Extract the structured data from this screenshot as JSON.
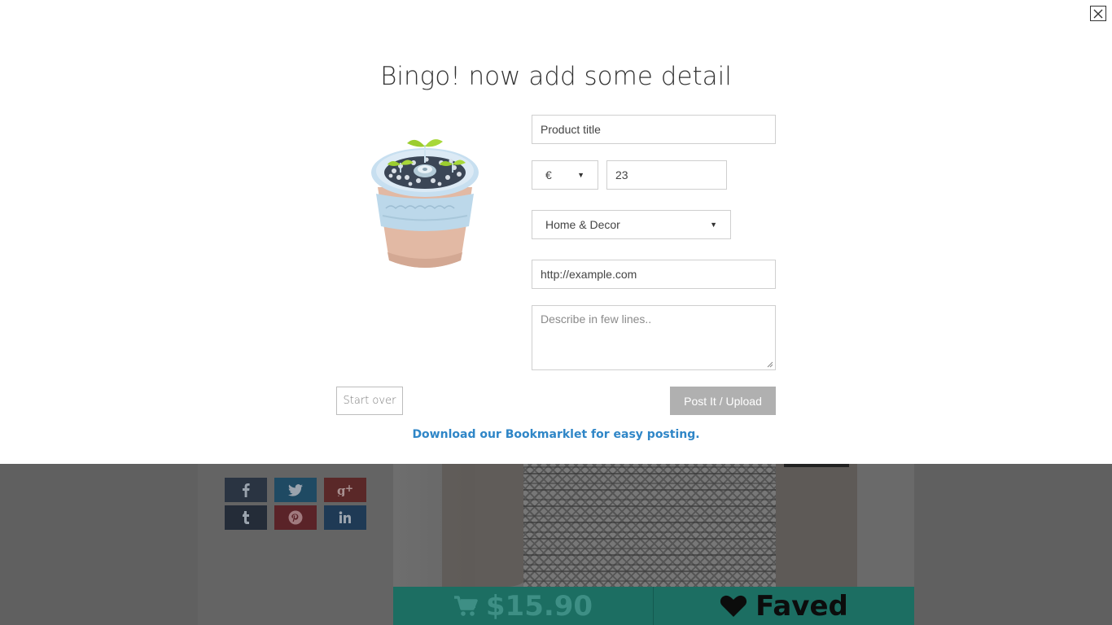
{
  "modal": {
    "title": "Bingo! now add some detail",
    "close_icon": "close-icon",
    "form": {
      "product_title_value": "Product title",
      "currency_value": "€",
      "price_value": "23",
      "category_value": "Home & Decor",
      "url_value": "http://example.com",
      "description_placeholder": "Describe in few lines.."
    },
    "start_over_label": "Start over",
    "post_label": "Post It / Upload",
    "bookmarklet_text": "Download our Bookmarklet for easy posting."
  },
  "background": {
    "share_icons": [
      "facebook-icon",
      "twitter-icon",
      "google-plus-icon",
      "tumblr-icon",
      "pinterest-icon",
      "linkedin-icon"
    ],
    "price_text": "$15.90",
    "faved_text": "Faved"
  },
  "colors": {
    "accent_link": "#2f86c7",
    "post_button": "#b0b0b0",
    "overlay": "#606060",
    "price_bar": "#1c6e62"
  }
}
